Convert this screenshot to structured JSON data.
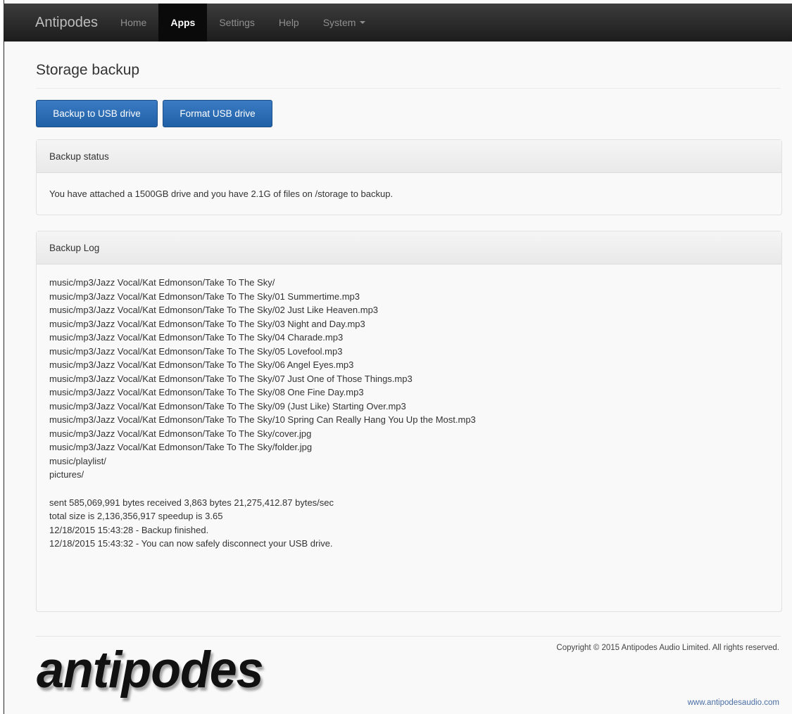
{
  "navbar": {
    "brand": "Antipodes",
    "items": [
      {
        "label": "Home"
      },
      {
        "label": "Apps"
      },
      {
        "label": "Settings"
      },
      {
        "label": "Help"
      },
      {
        "label": "System"
      }
    ],
    "active": "Apps"
  },
  "page": {
    "title": "Storage backup"
  },
  "buttons": {
    "backup_label": "Backup to USB drive",
    "format_label": "Format USB drive"
  },
  "status_panel": {
    "heading": "Backup status",
    "message": "You have attached a 1500GB drive and you have 2.1G of files on /storage to backup."
  },
  "log_panel": {
    "heading": "Backup Log",
    "lines": [
      "music/mp3/Jazz Vocal/Kat Edmonson/Take To The Sky/",
      "music/mp3/Jazz Vocal/Kat Edmonson/Take To The Sky/01 Summertime.mp3",
      "music/mp3/Jazz Vocal/Kat Edmonson/Take To The Sky/02 Just Like Heaven.mp3",
      "music/mp3/Jazz Vocal/Kat Edmonson/Take To The Sky/03 Night and Day.mp3",
      "music/mp3/Jazz Vocal/Kat Edmonson/Take To The Sky/04 Charade.mp3",
      "music/mp3/Jazz Vocal/Kat Edmonson/Take To The Sky/05 Lovefool.mp3",
      "music/mp3/Jazz Vocal/Kat Edmonson/Take To The Sky/06 Angel Eyes.mp3",
      "music/mp3/Jazz Vocal/Kat Edmonson/Take To The Sky/07 Just One of Those Things.mp3",
      "music/mp3/Jazz Vocal/Kat Edmonson/Take To The Sky/08 One Fine Day.mp3",
      "music/mp3/Jazz Vocal/Kat Edmonson/Take To The Sky/09 (Just Like) Starting Over.mp3",
      "music/mp3/Jazz Vocal/Kat Edmonson/Take To The Sky/10 Spring Can Really Hang You Up the Most.mp3",
      "music/mp3/Jazz Vocal/Kat Edmonson/Take To The Sky/cover.jpg",
      "music/mp3/Jazz Vocal/Kat Edmonson/Take To The Sky/folder.jpg",
      "music/playlist/",
      "pictures/"
    ],
    "summary": [
      "sent 585,069,991 bytes received 3,863 bytes 21,275,412.87 bytes/sec",
      "total size is 2,136,356,917 speedup is 3.65",
      "12/18/2015 15:43:28 - Backup finished.",
      "12/18/2015 15:43:32 - You can now safely disconnect your USB drive."
    ]
  },
  "footer": {
    "logo_text": "antipodes",
    "copyright": "Copyright © 2015 Antipodes Audio Limited. All rights reserved.",
    "website": "www.antipodesaudio.com"
  },
  "colors": {
    "navbar": "#1c1c1c",
    "primary_button": "#2a6db3",
    "link": "#4a6fa5"
  }
}
